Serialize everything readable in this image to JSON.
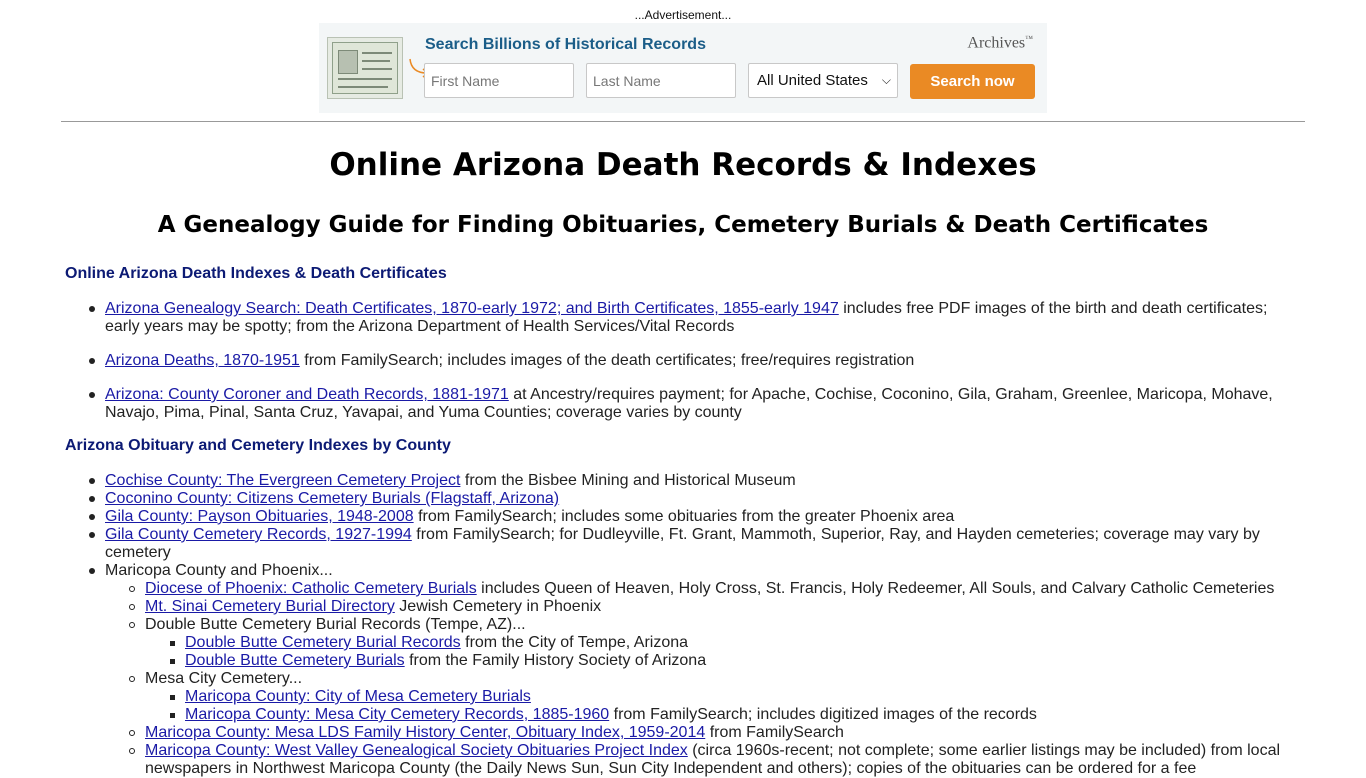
{
  "ad": {
    "label": "...Advertisement...",
    "headline": "Search Billions of Historical Records",
    "logo": "Archives",
    "logo_mark": "™",
    "first_name_placeholder": "First Name",
    "last_name_placeholder": "Last Name",
    "region": "All United States",
    "button": "Search now",
    "button_color": "#ea8a24",
    "headline_color": "#1b5d88"
  },
  "page": {
    "title": "Online Arizona Death Records & Indexes",
    "subtitle": "A Genealogy Guide for Finding Obituaries, Cemetery Burials & Death Certificates"
  },
  "section1": {
    "heading": "Online Arizona Death Indexes & Death Certificates",
    "items": [
      {
        "link": "Arizona Genealogy Search: Death Certificates, 1870-early 1972; and Birth Certificates, 1855-early 1947",
        "text": " includes free PDF images of the birth and death certificates; early years may be spotty; from the Arizona Department of Health Services/Vital Records"
      },
      {
        "link": "Arizona Deaths, 1870-1951",
        "text": " from FamilySearch; includes images of the death certificates; free/requires registration"
      },
      {
        "link": "Arizona: County Coroner and Death Records, 1881-1971",
        "text": " at Ancestry/requires payment; for Apache, Cochise, Coconino, Gila, Graham, Greenlee, Maricopa, Mohave, Navajo, Pima, Pinal, Santa Cruz, Yavapai, and Yuma Counties; coverage varies by county"
      }
    ]
  },
  "section2": {
    "heading": "Arizona Obituary and Cemetery Indexes by County",
    "items": [
      {
        "link": "Cochise County: The Evergreen Cemetery Project",
        "text": " from the Bisbee Mining and Historical Museum"
      },
      {
        "link": "Coconino County: Citizens Cemetery Burials (Flagstaff, Arizona)",
        "text": ""
      },
      {
        "link": "Gila County: Payson Obituaries, 1948-2008",
        "text": " from FamilySearch; includes some obituaries from the greater Phoenix area"
      },
      {
        "link": "Gila County Cemetery Records, 1927-1994",
        "text": " from FamilySearch; for Dudleyville, Ft. Grant, Mammoth, Superior, Ray, and Hayden cemeteries; coverage may vary by cemetery"
      },
      {
        "text": "Maricopa County and Phoenix..."
      },
      {
        "link": "Diocese of Phoenix: Catholic Cemetery Burials",
        "text": " includes Queen of Heaven, Holy Cross, St. Francis, Holy Redeemer, All Souls, and Calvary Catholic Cemeteries"
      },
      {
        "link": "Mt. Sinai Cemetery Burial Directory",
        "text": " Jewish Cemetery in Phoenix"
      },
      {
        "text": "Double Butte Cemetery Burial Records (Tempe, AZ)..."
      },
      {
        "link": "Double Butte Cemetery Burial Records",
        "text": " from the City of Tempe, Arizona"
      },
      {
        "link": "Double Butte Cemetery Burials",
        "text": " from the Family History Society of Arizona"
      },
      {
        "text": "Mesa City Cemetery..."
      },
      {
        "link": "Maricopa County: City of Mesa Cemetery Burials",
        "text": ""
      },
      {
        "link": "Maricopa County: Mesa City Cemetery Records, 1885-1960",
        "text": " from FamilySearch; includes digitized images of the records"
      },
      {
        "link": "Maricopa County: Mesa LDS Family History Center, Obituary Index, 1959-2014",
        "text": " from FamilySearch"
      },
      {
        "link": "Maricopa County: West Valley Genealogical Society Obituaries Project Index",
        "text": " (circa 1960s-recent; not complete; some earlier listings may be included) from local newspapers in Northwest Maricopa County (the Daily News Sun, Sun City Independent and others); copies of the obituaries can be ordered for a fee"
      }
    ]
  }
}
